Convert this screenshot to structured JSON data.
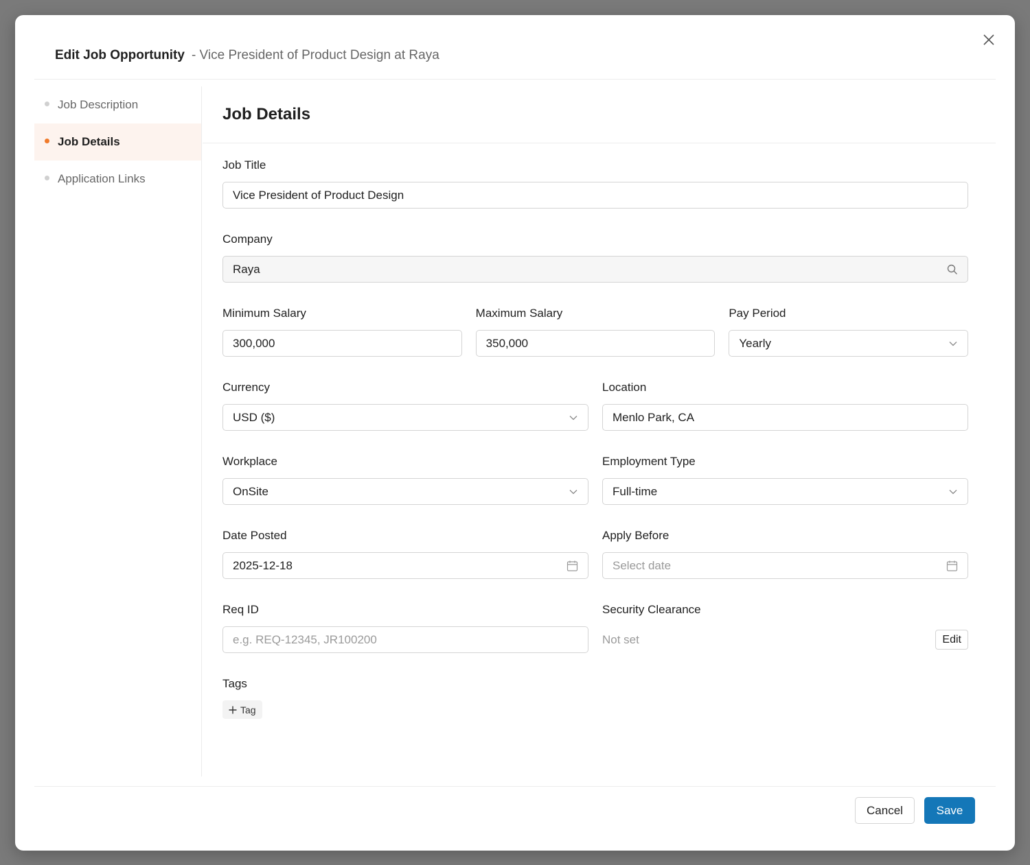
{
  "modal": {
    "title": "Edit Job Opportunity",
    "subtitle": "- Vice President of Product Design at Raya"
  },
  "sidebar": {
    "items": [
      {
        "label": "Job Description",
        "active": false
      },
      {
        "label": "Job Details",
        "active": true
      },
      {
        "label": "Application Links",
        "active": false
      }
    ]
  },
  "section": {
    "title": "Job Details"
  },
  "form": {
    "job_title": {
      "label": "Job Title",
      "value": "Vice President of Product Design"
    },
    "company": {
      "label": "Company",
      "value": "Raya"
    },
    "min_salary": {
      "label": "Minimum Salary",
      "value": "300,000"
    },
    "max_salary": {
      "label": "Maximum Salary",
      "value": "350,000"
    },
    "pay_period": {
      "label": "Pay Period",
      "value": "Yearly"
    },
    "currency": {
      "label": "Currency",
      "value": "USD ($)"
    },
    "location": {
      "label": "Location",
      "value": "Menlo Park, CA"
    },
    "workplace": {
      "label": "Workplace",
      "value": "OnSite"
    },
    "employment_type": {
      "label": "Employment Type",
      "value": "Full-time"
    },
    "date_posted": {
      "label": "Date Posted",
      "value": "2025-12-18"
    },
    "apply_before": {
      "label": "Apply Before",
      "placeholder": "Select date"
    },
    "req_id": {
      "label": "Req ID",
      "placeholder": "e.g. REQ-12345, JR100200"
    },
    "security_clearance": {
      "label": "Security Clearance",
      "value": "Not set",
      "edit_label": "Edit"
    },
    "tags": {
      "label": "Tags",
      "add_label": "Tag"
    }
  },
  "footer": {
    "cancel_label": "Cancel",
    "save_label": "Save"
  },
  "colors": {
    "accent": "#f07a2a",
    "primary": "#1477b8",
    "active_bg": "#fdf3ee"
  }
}
